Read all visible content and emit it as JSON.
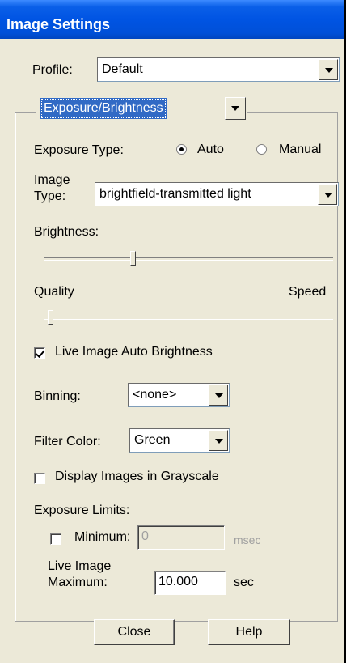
{
  "window": {
    "title": "Image Settings"
  },
  "profile": {
    "label": "Profile:",
    "value": "Default"
  },
  "panel": {
    "selector_value": "Exposure/Brightness"
  },
  "exposure_type": {
    "label": "Exposure Type:",
    "options": [
      "Auto",
      "Manual"
    ],
    "selected": "Auto"
  },
  "image_type": {
    "label_line1": "Image",
    "label_line2": "Type:",
    "value": "brightfield-transmitted light"
  },
  "brightness": {
    "label": "Brightness:",
    "level": 0.31
  },
  "quality_speed": {
    "left_label": "Quality",
    "right_label": "Speed",
    "level": 0.02
  },
  "live_auto_brightness": {
    "label": "Live Image Auto Brightness",
    "checked": true
  },
  "binning": {
    "label": "Binning:",
    "value": "<none>"
  },
  "filter_color": {
    "label": "Filter Color:",
    "value": "Green"
  },
  "grayscale": {
    "label": "Display Images in Grayscale",
    "checked": false
  },
  "exposure_limits": {
    "label": "Exposure Limits:",
    "minimum": {
      "label": "Minimum:",
      "value": "0",
      "unit": "msec",
      "checked": false
    },
    "maximum": {
      "label_line1": "Live Image",
      "label_line2": "Maximum:",
      "value": "10.000",
      "unit": "sec"
    }
  },
  "buttons": {
    "close": "Close",
    "help": "Help"
  }
}
